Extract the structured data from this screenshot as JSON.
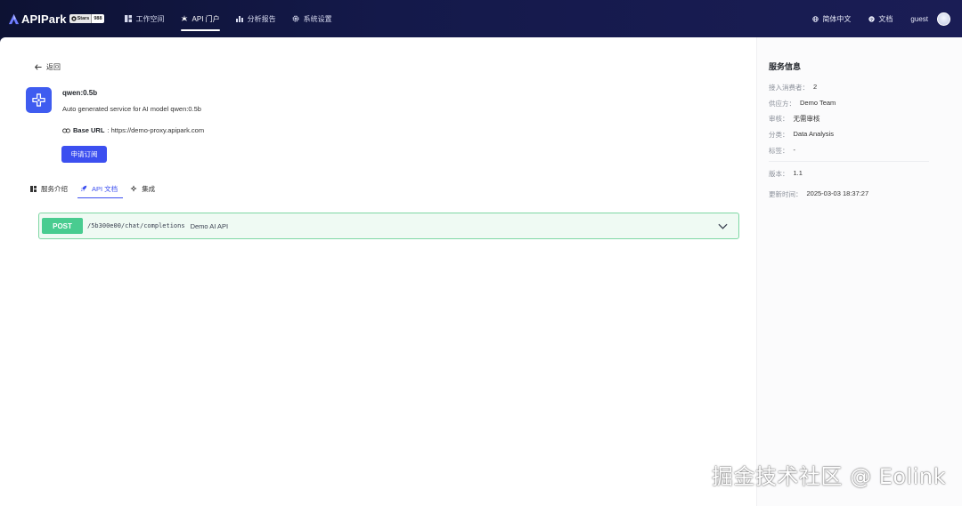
{
  "header": {
    "brand": "APIPark",
    "github_badge": {
      "label": "Stars",
      "count": "988"
    },
    "nav": [
      {
        "label": "工作空间",
        "icon": "grid-icon"
      },
      {
        "label": "API 门户",
        "icon": "sparkle-icon",
        "active": true
      },
      {
        "label": "分析报告",
        "icon": "bar-chart-icon"
      },
      {
        "label": "系统设置",
        "icon": "gear-icon"
      }
    ],
    "right": {
      "language": "简体中文",
      "docs": "文档",
      "user": "guest"
    }
  },
  "main": {
    "back_label": "返回",
    "service": {
      "name": "qwen:0.5b",
      "description": "Auto generated service for AI model qwen:0.5b",
      "base_url_label": "Base URL",
      "base_url_value": ": https://demo-proxy.apipark.com",
      "subscribe_label": "申请订阅"
    },
    "tabs": [
      {
        "label": "服务介绍",
        "icon": "doc-icon"
      },
      {
        "label": "API 文档",
        "icon": "rocket-icon",
        "active": true
      },
      {
        "label": "集成",
        "icon": "integration-icon"
      }
    ],
    "api": {
      "method": "POST",
      "path": "/5b300e00/chat/completions",
      "summary": "Demo AI API"
    }
  },
  "sidebar": {
    "title": "服务信息",
    "rows": [
      {
        "key": "接入消费者：",
        "value": "2"
      },
      {
        "key": "供应方：",
        "value": "Demo Team"
      },
      {
        "key": "审核：",
        "value": "无需审核"
      },
      {
        "key": "分类：",
        "value": "Data Analysis"
      },
      {
        "key": "标签：",
        "value": "-"
      }
    ],
    "rows2": [
      {
        "key": "版本：",
        "value": "1.1"
      },
      {
        "key": "更新时间：",
        "value": "2025-03-03 18:37:27"
      }
    ]
  },
  "watermark": "掘金技术社区 @ Eolink",
  "colors": {
    "accent": "#3c4ff0",
    "post": "#49cc90",
    "topbar": "#14194a"
  }
}
